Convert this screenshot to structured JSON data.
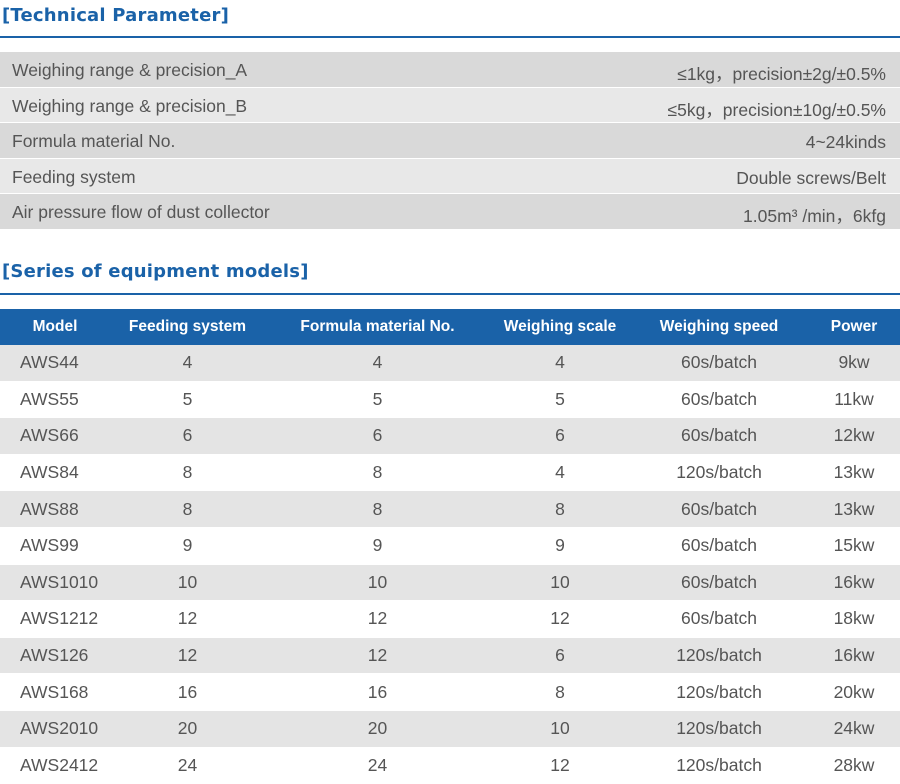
{
  "technical": {
    "title": "[Technical Parameter]",
    "rows": [
      {
        "label": "Weighing range & precision_A",
        "value": "≤1kg，precision±2g/±0.5%"
      },
      {
        "label": "Weighing range & precision_B",
        "value": "≤5kg，precision±10g/±0.5%"
      },
      {
        "label": "Formula material No.",
        "value": "4~24kinds"
      },
      {
        "label": "Feeding system",
        "value": "Double screws/Belt"
      },
      {
        "label": "Air pressure flow of dust collector",
        "value": "1.05m³ /min，6kfg"
      }
    ]
  },
  "series": {
    "title": "[Series of equipment models]",
    "headers": [
      "Model",
      "Feeding system",
      "Formula material No.",
      "Weighing scale",
      "Weighing speed",
      "Power"
    ],
    "rows": [
      [
        "AWS44",
        "4",
        "4",
        "4",
        "60s/batch",
        "9kw"
      ],
      [
        "AWS55",
        "5",
        "5",
        "5",
        "60s/batch",
        "11kw"
      ],
      [
        "AWS66",
        "6",
        "6",
        "6",
        "60s/batch",
        "12kw"
      ],
      [
        "AWS84",
        "8",
        "8",
        "4",
        "120s/batch",
        "13kw"
      ],
      [
        "AWS88",
        "8",
        "8",
        "8",
        "60s/batch",
        "13kw"
      ],
      [
        "AWS99",
        "9",
        "9",
        "9",
        "60s/batch",
        "15kw"
      ],
      [
        "AWS1010",
        "10",
        "10",
        "10",
        "60s/batch",
        "16kw"
      ],
      [
        "AWS1212",
        "12",
        "12",
        "12",
        "60s/batch",
        "18kw"
      ],
      [
        "AWS126",
        "12",
        "12",
        "6",
        "120s/batch",
        "16kw"
      ],
      [
        "AWS168",
        "16",
        "16",
        "8",
        "120s/batch",
        "20kw"
      ],
      [
        "AWS2010",
        "20",
        "20",
        "10",
        "120s/batch",
        "24kw"
      ],
      [
        "AWS2412",
        "24",
        "24",
        "12",
        "120s/batch",
        "28kw"
      ]
    ]
  }
}
